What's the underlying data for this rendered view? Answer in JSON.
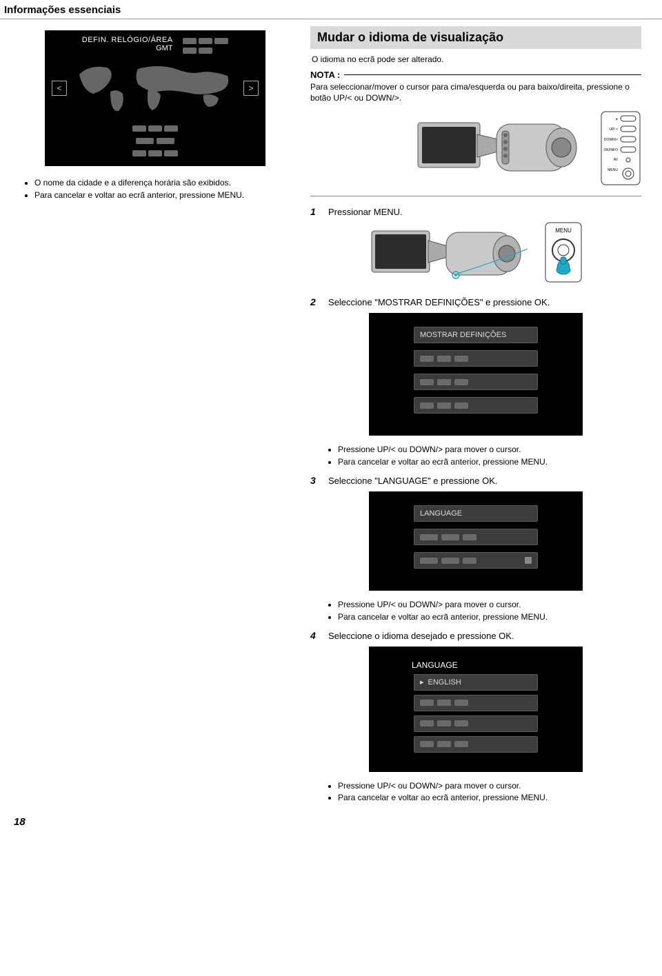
{
  "breadcrumb": "Informações essenciais",
  "left": {
    "lcd_title_l1": "DEFIN. RELÓGIO/ÁREA",
    "lcd_title_l2": "GMT",
    "bullets": [
      "O nome da cidade e a diferença horária são exibidos.",
      "Para cancelar e voltar ao ecrã anterior, pressione MENU."
    ]
  },
  "right": {
    "header": "Mudar o idioma de visualização",
    "lead": "O idioma no ecrã pode ser alterado.",
    "nota_label": "NOTA :",
    "nota_text": "Para seleccionar/mover o cursor para cima/esquerda ou para baixo/direita, pressione o botão UP/< ou DOWN/>.",
    "panel_labels": {
      "play": "▸",
      "up": "UP/ <",
      "down": "DOWN/>",
      "ok": "OK/INFO",
      "av": "AV",
      "menu": "MENU"
    },
    "steps": {
      "s1": {
        "num": "1",
        "txt": "Pressionar MENU."
      },
      "s2": {
        "num": "2",
        "txt": "Seleccione \"MOSTRAR DEFINIÇÕES\" e pressione OK."
      },
      "s2_menu_opt": "MOSTRAR DEFINIÇÕES",
      "s2_bullets": [
        "Pressione UP/< ou DOWN/> para mover o cursor.",
        "Para cancelar e voltar ao ecrã anterior, pressione MENU."
      ],
      "s3": {
        "num": "3",
        "txt": "Seleccione \"LANGUAGE\" e pressione OK."
      },
      "s3_menu_opt": "LANGUAGE",
      "s3_bullets": [
        "Pressione UP/< ou DOWN/> para mover o cursor.",
        "Para cancelar e voltar ao ecrã anterior, pressione MENU."
      ],
      "s4": {
        "num": "4",
        "txt": "Seleccione o idioma desejado e pressione OK."
      },
      "s4_title": "LANGUAGE",
      "s4_opt": "ENGLISH",
      "s4_bullets": [
        "Pressione UP/< ou DOWN/> para mover o cursor.",
        "Para cancelar e voltar ao ecrã anterior, pressione MENU."
      ]
    },
    "menu_btn_label": "MENU"
  },
  "page_number": "18"
}
